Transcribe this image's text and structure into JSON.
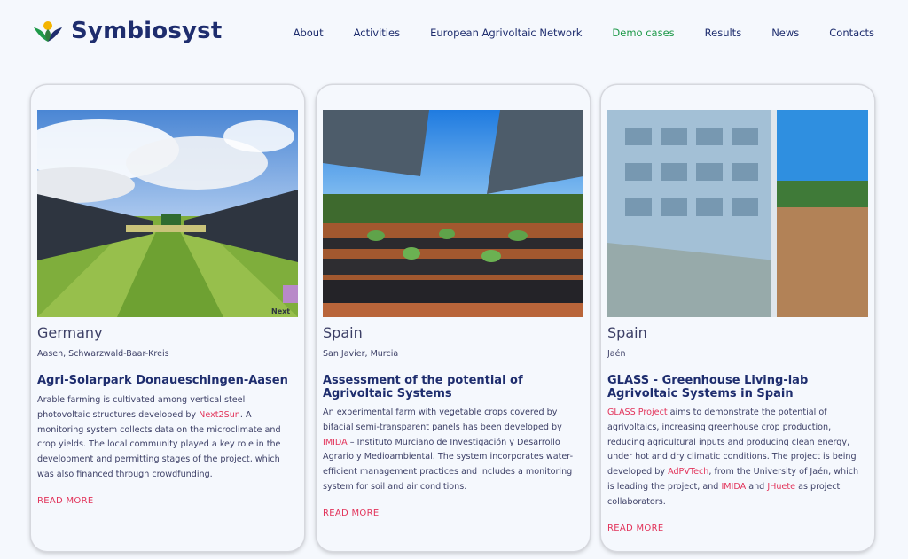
{
  "brand": {
    "name": "Symbiosyst"
  },
  "nav": {
    "items": [
      "About",
      "Activities",
      "European Agrivoltaic Network",
      "Demo cases",
      "Results",
      "News",
      "Contacts"
    ],
    "active": "Demo cases"
  },
  "cards": [
    {
      "country": "Germany",
      "location": "Aasen, Schwarzwald-Baar-Kreis",
      "title": "Agri-Solarpark Donaueschingen-Aasen",
      "desc": [
        {
          "t": "Arable farming is cultivated among vertical steel photovoltaic structures developed by "
        },
        {
          "t": "Next2Sun",
          "link": true
        },
        {
          "t": ". A monitoring system collects data on the microclimate and crop yields. The local community played a key role in the development and permitting stages of the project, which was also financed through crowdfunding."
        }
      ],
      "read_more": "READ MORE",
      "image_label": "Next"
    },
    {
      "country": "Spain",
      "location": "San Javier, Murcia",
      "title": "Assessment of the potential of Agrivoltaic Systems",
      "desc": [
        {
          "t": "An experimental farm with vegetable crops covered by bifacial semi-transparent panels has been developed by "
        },
        {
          "t": "IMIDA",
          "link": true
        },
        {
          "t": " – Instituto Murciano de Investigación y Desarrollo Agrario y Medioambiental. The system incorporates water-efficient management practices and includes a monitoring system for soil and air conditions."
        }
      ],
      "read_more": "READ MORE"
    },
    {
      "country": "Spain",
      "location": "Jaén",
      "title": "GLASS - Greenhouse Living-lab Agrivoltaic Systems in Spain",
      "desc": [
        {
          "t": "GLASS Project",
          "link": true
        },
        {
          "t": " aims to demonstrate the potential of agrivoltaics, increasing greenhouse crop production, reducing agricultural inputs and producing clean energy, under hot and dry climatic conditions. The project is being developed by "
        },
        {
          "t": "AdPVTech",
          "link": true
        },
        {
          "t": ", from the University of Jaén, which is leading the project, and "
        },
        {
          "t": "IMIDA",
          "link": true
        },
        {
          "t": " and "
        },
        {
          "t": "JHuete",
          "link": true
        },
        {
          "t": " as project collaborators."
        }
      ],
      "read_more": "READ MORE"
    }
  ],
  "colors": {
    "brand": "#1e2d6e",
    "active_nav": "#1f9a4a",
    "link": "#e2335a",
    "text": "#3c3f66",
    "background": "#f5f8fd"
  }
}
